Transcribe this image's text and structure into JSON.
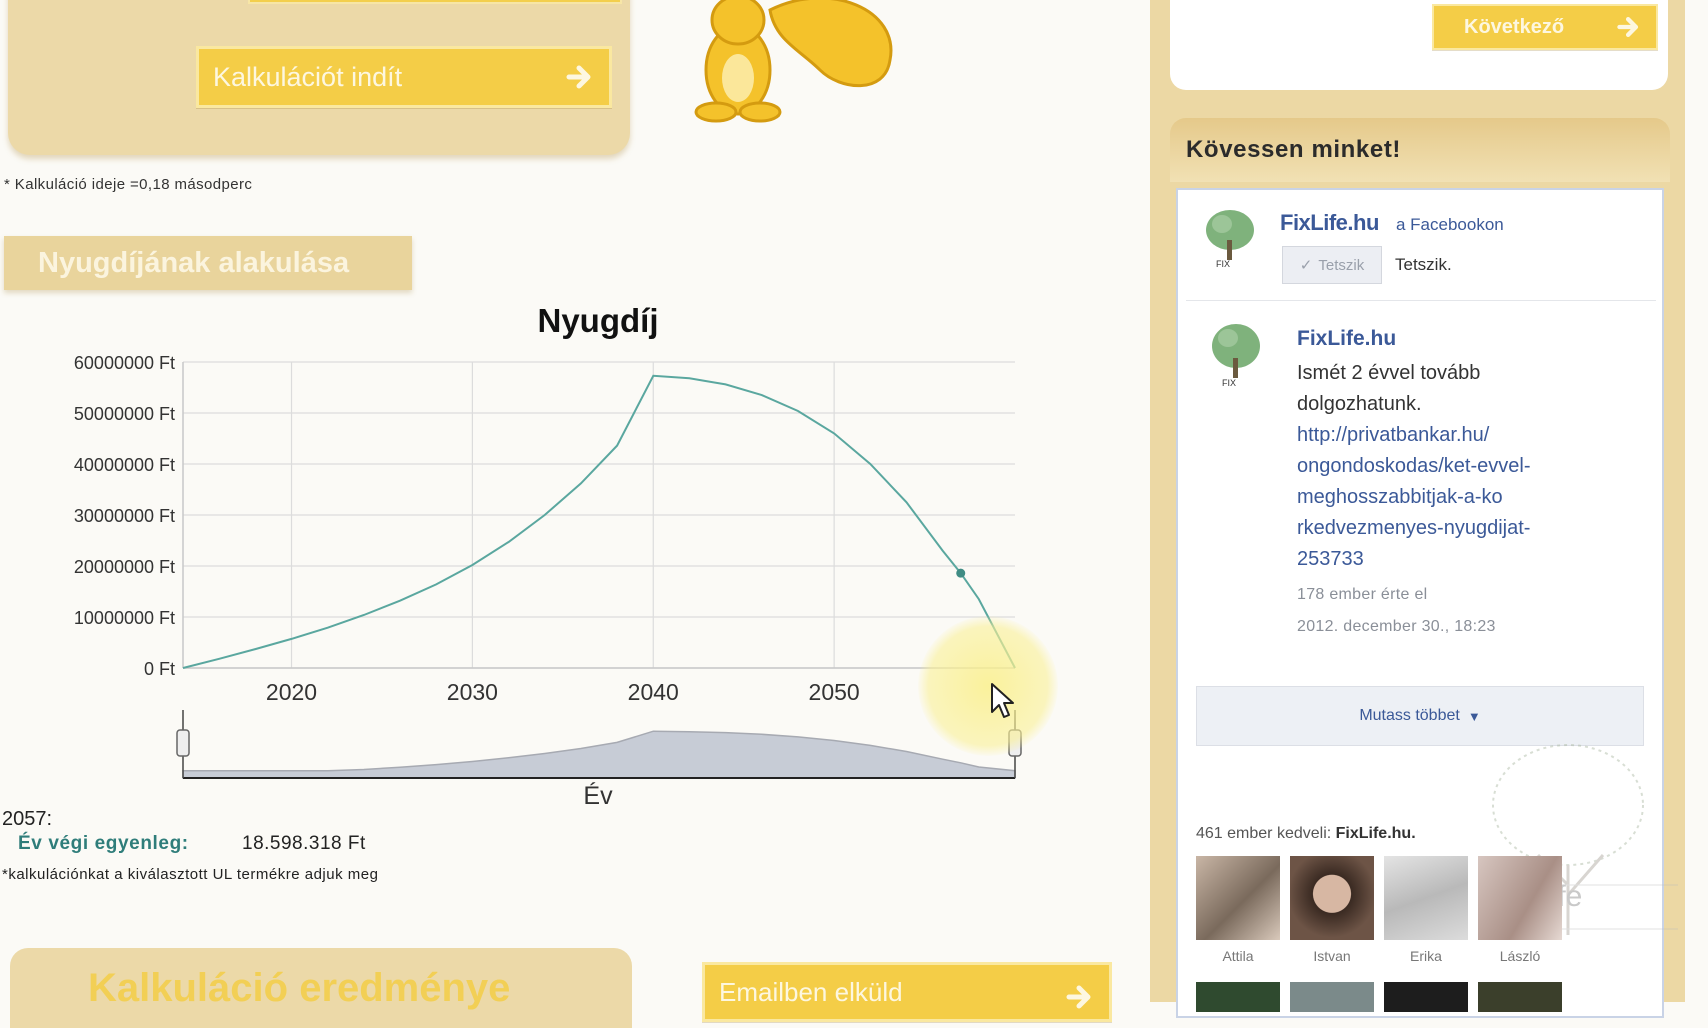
{
  "calc": {
    "start_button": "Kalkulációt indít",
    "time_note": "* Kalkuláció ideje =0,18 másodperc"
  },
  "section": {
    "title": "Nyugdíjának alakulása"
  },
  "chart_data": {
    "type": "line",
    "title": "Nyugdíj",
    "xlabel": "Év",
    "ylabel": "",
    "x_ticks": [
      2020,
      2030,
      2040,
      2050
    ],
    "y_ticks": [
      "0 Ft",
      "10000000 Ft",
      "20000000 Ft",
      "30000000 Ft",
      "40000000 Ft",
      "50000000 Ft",
      "60000000 Ft"
    ],
    "xlim": [
      2014,
      2060
    ],
    "ylim": [
      0,
      60000000
    ],
    "series": [
      {
        "color": "#5aa79f",
        "x": [
          2014,
          2016,
          2018,
          2020,
          2022,
          2024,
          2026,
          2028,
          2030,
          2032,
          2034,
          2036,
          2038,
          2040,
          2042,
          2044,
          2046,
          2048,
          2050,
          2052,
          2054,
          2056,
          2057,
          2058,
          2060
        ],
        "y": [
          0,
          1800000,
          3700000,
          5700000,
          7900000,
          10400000,
          13200000,
          16400000,
          20200000,
          24700000,
          30000000,
          36200000,
          43600000,
          57300000,
          56800000,
          55600000,
          53500000,
          50400000,
          46000000,
          40000000,
          32500000,
          23000000,
          18598318,
          13500000,
          0
        ]
      }
    ],
    "highlight": {
      "x": 2057,
      "y": 18598318
    },
    "grid": true,
    "navigator": true
  },
  "result": {
    "year": "2057:",
    "label": "Év végi egyenleg:",
    "value": "18.598.318 Ft",
    "note": "*kalkulációnkat a kiválasztott UL termékre adjuk meg"
  },
  "bottom": {
    "panel_title": "Kalkuláció eredménye",
    "email_button": "Emailben elküld"
  },
  "sidebar": {
    "next_button": "Következő",
    "follow_title": "Kövessen minket!",
    "fb": {
      "page_name": "FixLife.hu",
      "on_facebook": "a Facebookon",
      "like_button": "Tetszik",
      "like_text": "Tetszik.",
      "post_author": "FixLife.hu",
      "post_text": "Ismét 2 évvel tovább dolgozhatunk.",
      "post_link": "http://privatbankar.hu/ongondoskodas/ket-evvel-meghosszabbitjak-a-kokedvezmenyes-nyugdijat-253733",
      "post_link_lines": [
        "http://privatbankar.hu/",
        "ongondoskodas/ket-evvel-",
        "meghosszabbitjak-a-ko",
        "rkedvezmenyes-nyugdijat-",
        "253733"
      ],
      "post_likes": "178 ember érte el",
      "post_date": "2012. december 30., 18:23",
      "show_more": "Mutass többet",
      "fans_count": "461 ember kedveli:",
      "fans_page": "FixLife.hu.",
      "fans": [
        "Attila",
        "Istvan",
        "Erika",
        "László"
      ]
    },
    "watermark": "life"
  }
}
